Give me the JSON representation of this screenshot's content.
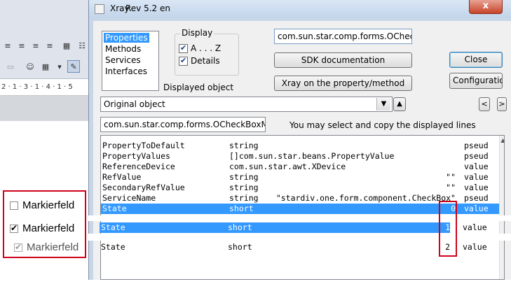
{
  "writer": {
    "ruler_text": "2 · 1 · 3 · 1 · 4 · 1 · 5",
    "checkboxes": [
      {
        "label": "Markierfeld",
        "state": "unchecked"
      },
      {
        "label": "Markierfeld",
        "state": "checked"
      },
      {
        "label": "Markierfeld",
        "state": "indeterminate"
      }
    ]
  },
  "xray": {
    "title": "Xray",
    "version": "Rev 5.2 en",
    "title_close": "x",
    "methods_list": [
      "Properties",
      "Methods",
      "Services",
      "Interfaces"
    ],
    "methods_selected": "Properties",
    "display_group": {
      "legend": "Display",
      "options": [
        {
          "label": "A . . . Z",
          "checked": true
        },
        {
          "label": "Details",
          "checked": true
        }
      ]
    },
    "displayed_object_label": "Displayed object",
    "object_name": "com.sun.star.comp.forms.OCheckBc",
    "sdk_button": "SDK documentation",
    "xray_button": "Xray on the property/method",
    "close_button": "Close",
    "config_button": "Configuration",
    "combo_value": "Original object",
    "up_glyph": "▲",
    "prev_glyph": "<",
    "next_glyph": ">",
    "type_name": "com.sun.star.comp.forms.OCheckBoxMc",
    "hint": "You may select and copy the displayed lines",
    "rows": [
      {
        "name": "PropertyToDefault",
        "type": "string",
        "value": "",
        "kind": "pseud"
      },
      {
        "name": "PropertyValues",
        "type": "[]com.sun.star.beans.PropertyValue",
        "value": "",
        "kind": "pseud"
      },
      {
        "name": "ReferenceDevice",
        "type": "com.sun.star.awt.XDevice",
        "value": "",
        "kind": "value"
      },
      {
        "name": "RefValue",
        "type": "string",
        "value": "\"\"",
        "kind": "value"
      },
      {
        "name": "SecondaryRefValue",
        "type": "string",
        "value": "\"\"",
        "kind": "value"
      },
      {
        "name": "ServiceName",
        "type": "string",
        "value": "\"stardiv.one.form.component.CheckBox\"",
        "kind": "pseud"
      },
      {
        "name": "State",
        "type": "short",
        "value": "0",
        "kind": "value",
        "highlight": true
      }
    ],
    "row_second": {
      "name": "State",
      "type": "short",
      "value": "1",
      "kind": "value"
    },
    "row_third": {
      "name": "State",
      "type": "short",
      "value": "2",
      "kind": "value"
    }
  }
}
